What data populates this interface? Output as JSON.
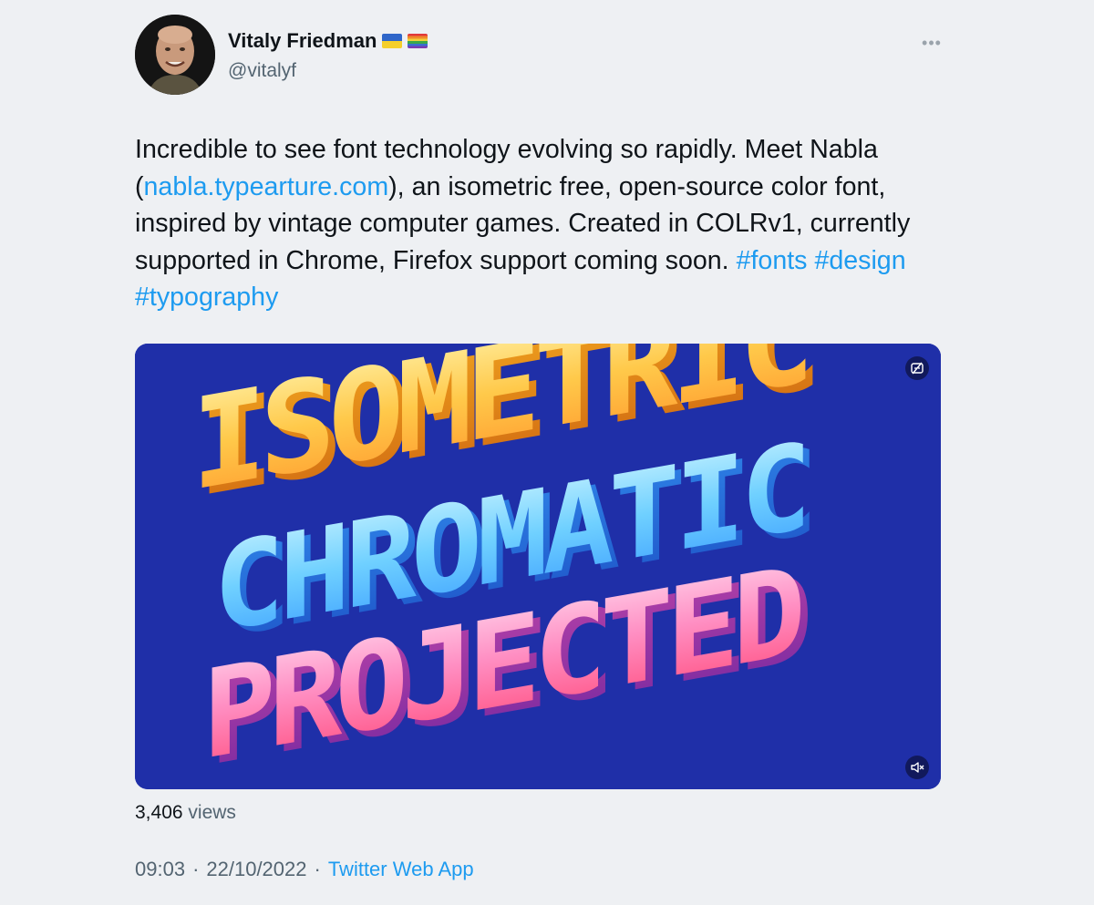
{
  "author": {
    "display_name": "Vitaly Friedman",
    "handle": "@vitalyf",
    "flags": [
      "ukraine-flag-icon",
      "rainbow-flag-icon"
    ]
  },
  "tweet": {
    "text_1": "Incredible to see font technology evolving so rapidly. Meet Nabla (",
    "link": "nabla.typearture.com",
    "text_2": "), an isometric free, open-source color font, inspired by vintage computer games. Created in COLRv1, currently supported in Chrome, Firefox support coming soon. ",
    "hashtags": [
      "#fonts",
      "#design",
      "#typography"
    ]
  },
  "media": {
    "lines": [
      "ISOMETRIC",
      "CHROMATIC",
      "PROJECTED"
    ],
    "background": "#1f2fa8"
  },
  "stats": {
    "views_count": "3,406",
    "views_label": "views"
  },
  "meta": {
    "time": "09:03",
    "separator": "·",
    "date": "22/10/2022",
    "source": "Twitter Web App"
  },
  "colors": {
    "link": "#1d9bf0",
    "secondary_text": "#536471",
    "page_bg": "#eef0f3"
  }
}
